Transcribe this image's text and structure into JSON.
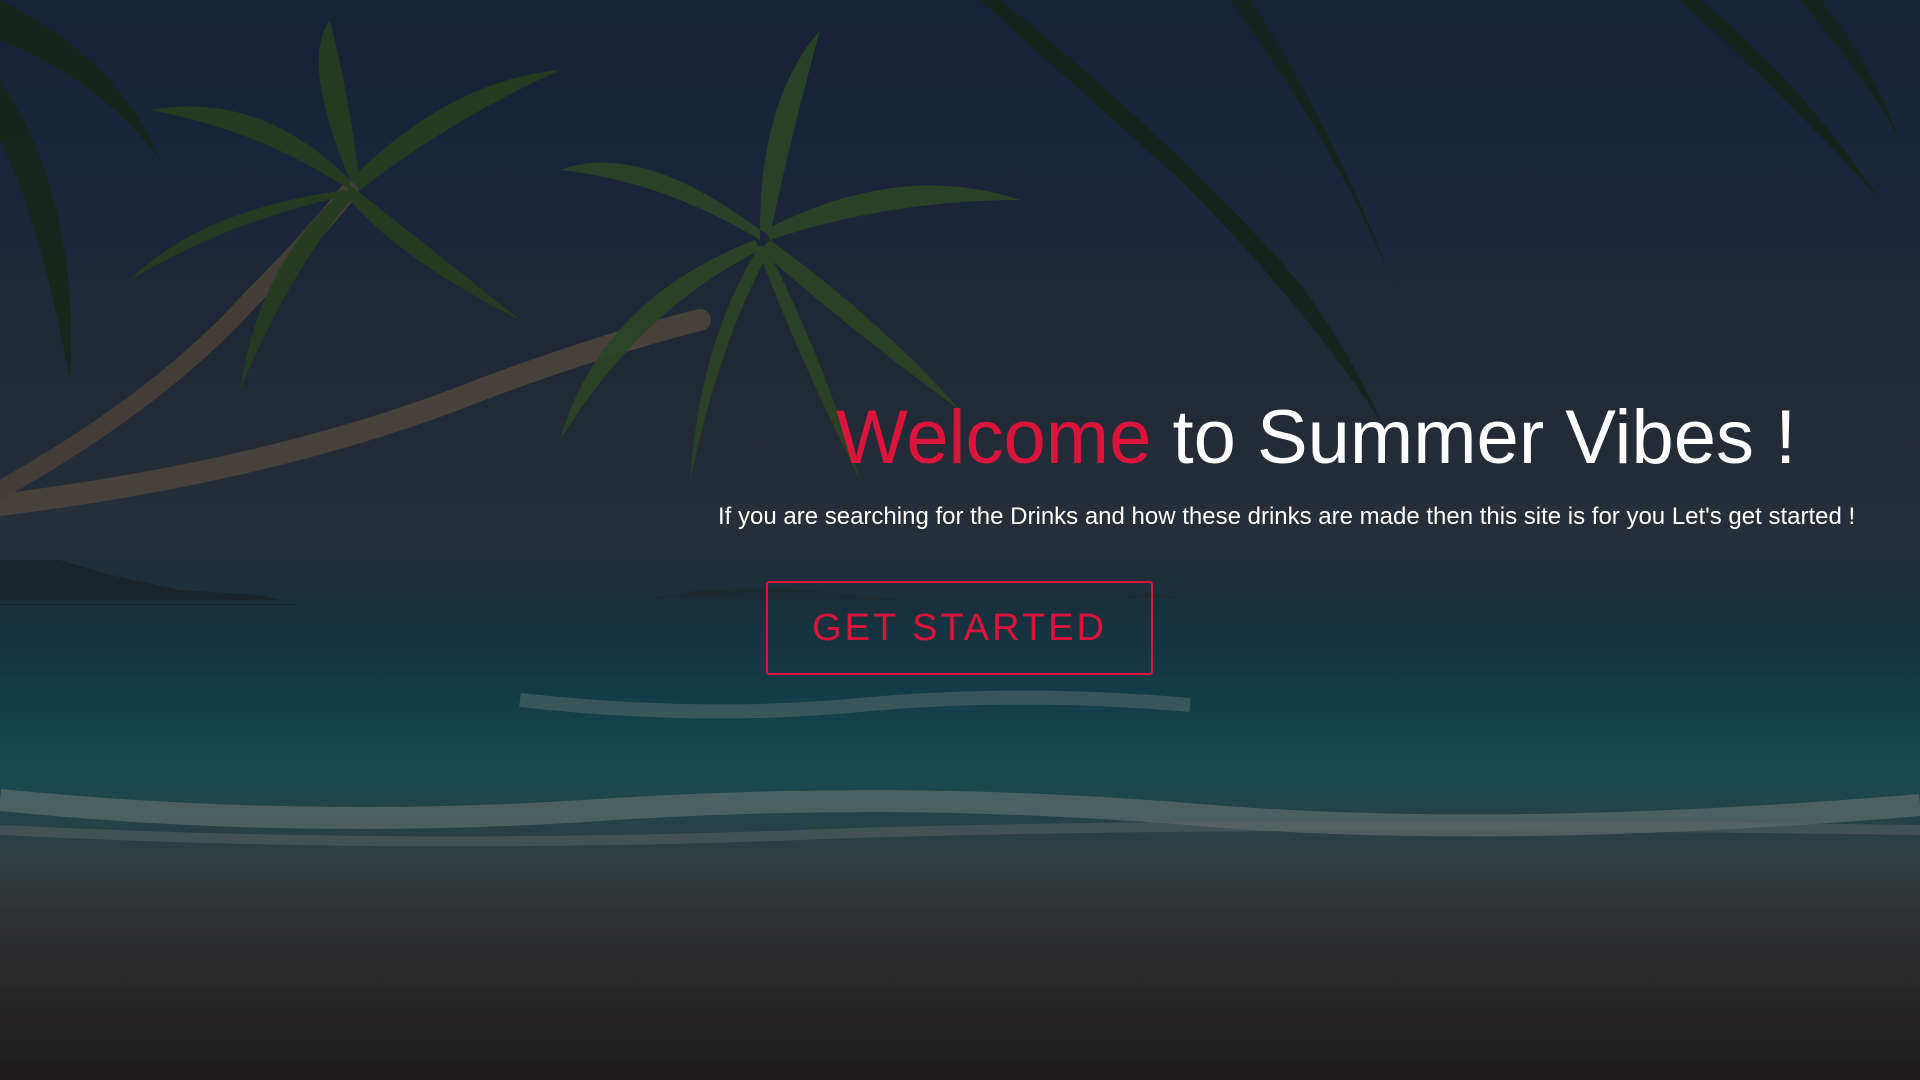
{
  "hero": {
    "headline_accent": "Welcome",
    "headline_rest": " to Summer Vibes !",
    "tagline": "If you are searching for the Drinks and how these drinks are made then this site is for you Let's get started !",
    "cta_label": "GET STARTED"
  },
  "colors": {
    "accent": "#dc143c",
    "text": "#ffffff"
  }
}
